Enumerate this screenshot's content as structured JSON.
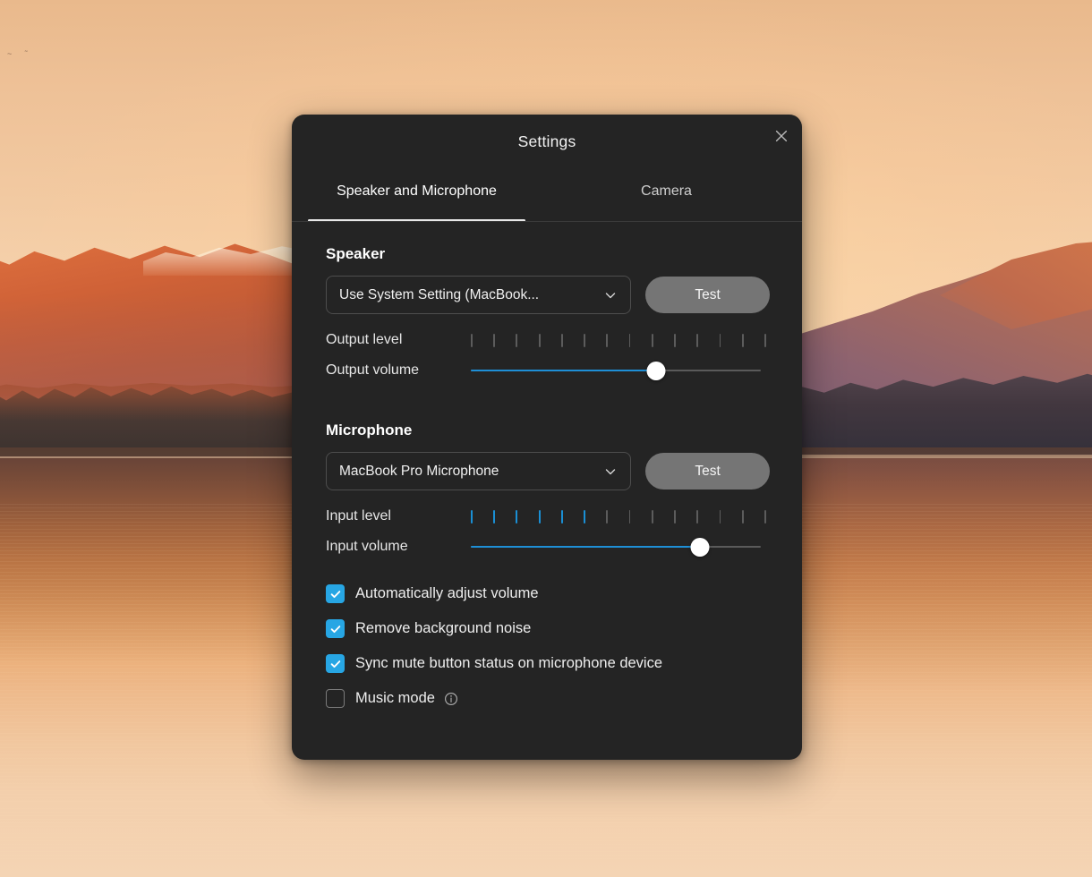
{
  "desktop": {
    "wallpaper_description": "sunset-lake-mountains"
  },
  "dialog": {
    "title": "Settings",
    "close_label": "×",
    "tabs": [
      {
        "label": "Speaker and Microphone",
        "active": true
      },
      {
        "label": "Camera",
        "active": false
      }
    ],
    "speaker": {
      "section_title": "Speaker",
      "device_value": "Use System Setting (MacBook...",
      "test_label": "Test",
      "output_level_label": "Output level",
      "output_level_total_ticks": 14,
      "output_level_active_ticks": 0,
      "output_volume_label": "Output volume",
      "output_volume_percent": 64
    },
    "microphone": {
      "section_title": "Microphone",
      "device_value": "MacBook Pro Microphone",
      "test_label": "Test",
      "input_level_label": "Input level",
      "input_level_total_ticks": 14,
      "input_level_active_ticks": 6,
      "input_volume_label": "Input volume",
      "input_volume_percent": 79,
      "options": [
        {
          "label": "Automatically adjust volume",
          "checked": true
        },
        {
          "label": "Remove background noise",
          "checked": true
        },
        {
          "label": "Sync mute button status on microphone device",
          "checked": true
        },
        {
          "label": "Music mode",
          "checked": false,
          "info": true
        }
      ]
    }
  },
  "colors": {
    "dialog_bg": "#242424",
    "accent_blue": "#27a6e4",
    "slider_blue": "#1e8fd6",
    "meter_blue": "#1a8fd4",
    "test_button": "#757575",
    "tab_underline": "#e8e8e8"
  }
}
